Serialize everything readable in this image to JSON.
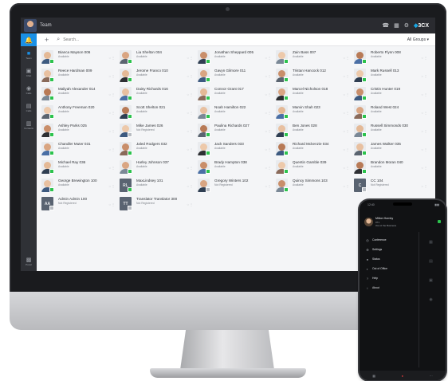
{
  "app": {
    "title": "Team",
    "brand": "3CX",
    "accent": "#1a90e6",
    "presence_color": "#2cc24d"
  },
  "title_icons": [
    "phone-icon",
    "grid-icon",
    "settings-icon"
  ],
  "rail": {
    "items": [
      {
        "label": "Team",
        "icon": "people-icon"
      },
      {
        "label": "Chat",
        "icon": "chat-icon"
      },
      {
        "label": "Calls",
        "icon": "calls-icon"
      },
      {
        "label": "Calls",
        "icon": "recent-calls-icon"
      },
      {
        "label": "Contacts",
        "icon": "contacts-icon"
      }
    ],
    "bottom": {
      "label": "Panel",
      "icon": "panel-icon"
    }
  },
  "toolbar": {
    "search_placeholder": "Search...",
    "groups_label": "All Groups ▾"
  },
  "contacts": [
    {
      "name": "Bianca Mayson 006",
      "status": "Available"
    },
    {
      "name": "Lia Shelton 004",
      "status": "Available"
    },
    {
      "name": "Jonathan Sheppard 005",
      "status": "Available"
    },
    {
      "name": "Zain Bass 007",
      "status": "Available"
    },
    {
      "name": "Roberto Flynn 008",
      "status": "Available"
    },
    {
      "name": "Reece Hardman 009",
      "status": "Available"
    },
    {
      "name": "Jerome Franco 010",
      "status": "Available"
    },
    {
      "name": "Gavyn Gilmore 011",
      "status": "Available"
    },
    {
      "name": "Tristan Hancock 012",
      "status": "Available"
    },
    {
      "name": "Mark Russell 013",
      "status": "Available"
    },
    {
      "name": "Maliyah Alexander 014",
      "status": "Available"
    },
    {
      "name": "Daisy Richards 016",
      "status": "Available"
    },
    {
      "name": "Connor Grant 017",
      "status": "Available"
    },
    {
      "name": "Marcel Nicholson 018",
      "status": "Available"
    },
    {
      "name": "Cristin Hunter 019",
      "status": "Available"
    },
    {
      "name": "Anthony Freeman 020",
      "status": "Available"
    },
    {
      "name": "Scott Shelton 021",
      "status": "Available"
    },
    {
      "name": "Noah Hamilton 022",
      "status": "Available"
    },
    {
      "name": "Marvin Shah 023",
      "status": "Available"
    },
    {
      "name": "Roland West 024",
      "status": "Available"
    },
    {
      "name": "Ashley Parks 025",
      "status": "Available"
    },
    {
      "name": "Mike James 026",
      "status": "Not Registered"
    },
    {
      "name": "Paulina Richards 027",
      "status": "Available"
    },
    {
      "name": "Ben Jones 028",
      "status": "Available"
    },
    {
      "name": "Russell Simmonds 030",
      "status": "Available"
    },
    {
      "name": "Chandler Muter 031",
      "status": "Available"
    },
    {
      "name": "Jaled Rodgers 032",
      "status": "Available"
    },
    {
      "name": "Jack Sanders 033",
      "status": "Available"
    },
    {
      "name": "Richard Mckenzie 034",
      "status": "Available"
    },
    {
      "name": "James Walker 035",
      "status": "Available"
    },
    {
      "name": "Michael Ray 036",
      "status": "Available"
    },
    {
      "name": "Harley Johnson 037",
      "status": "Available"
    },
    {
      "name": "Brady Hampton 038",
      "status": "Available"
    },
    {
      "name": "Quentin Gamble 039",
      "status": "Available"
    },
    {
      "name": "Brandon Moran 040",
      "status": "Available"
    },
    {
      "name": "George Brewington 100",
      "status": "Available"
    },
    {
      "name": "MaxLindsey 101",
      "status": "Available",
      "initials": "RL"
    },
    {
      "name": "Gregory Winters 102",
      "status": "Not Registered"
    },
    {
      "name": "Quincy Simmons 103",
      "status": "Available"
    },
    {
      "name": "CC 104",
      "status": "Not Registered",
      "initials": "C"
    },
    {
      "name": "Admin Admin 100",
      "status": "Not Registered",
      "initials": "AA"
    },
    {
      "name": "Translator Translator 300",
      "status": "Not Registered",
      "initials": "TT"
    }
  ],
  "phone": {
    "time": "12:40",
    "battery": "▮▮▮",
    "user_name": "Milton Hornby",
    "user_ext": "071",
    "user_status": "Out of the Business",
    "menu": [
      {
        "label": "Conference",
        "icon": "conference-icon"
      },
      {
        "label": "Settings",
        "icon": "settings-icon"
      },
      {
        "label": "Status",
        "icon": "status-icon"
      },
      {
        "label": "Out of Office",
        "icon": "out-of-office-icon"
      },
      {
        "label": "Help",
        "icon": "help-icon"
      },
      {
        "label": "About",
        "icon": "about-icon"
      }
    ]
  }
}
